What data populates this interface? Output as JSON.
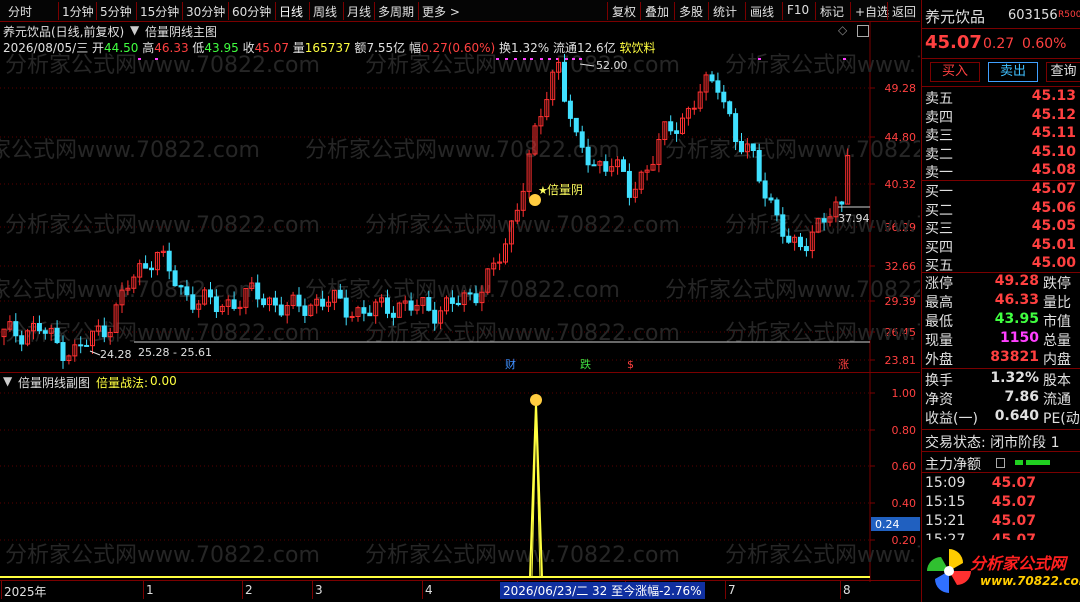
{
  "toolbar": {
    "left": [
      "分时",
      "1分钟",
      "5分钟",
      "15分钟",
      "30分钟",
      "60分钟",
      "日线",
      "周线",
      "月线",
      "多周期",
      "更多 >"
    ],
    "right": [
      "复权",
      "叠加",
      "多股",
      "统计",
      "画线",
      "F10",
      "标记",
      "+自选",
      "返回"
    ]
  },
  "main": {
    "title": "养元饮品(日线,前复权)",
    "indicator": "倍量阴线主图",
    "info": {
      "date": "2026/08/05/三",
      "open_label": "开",
      "open": "44.50",
      "high_label": "高",
      "high": "46.33",
      "low_label": "低",
      "low": "43.95",
      "close_label": "收",
      "close": "45.07",
      "vol_label": "量",
      "vol": "165737",
      "amt_label": "额",
      "amt": "7.55亿",
      "chg_label": "幅",
      "chg": "0.27(0.60%)",
      "turnover": "换1.32%",
      "float": "流通12.6亿",
      "sector": "软饮料"
    },
    "price_axis": [
      "49.28",
      "44.80",
      "40.32",
      "36.29",
      "32.66",
      "29.39",
      "26.45",
      "23.81"
    ],
    "annotations": {
      "high_mark": "52.00",
      "low_mark": "24.28",
      "range": "25.28 - 25.61",
      "signal": "倍量阴",
      "last": "37.94"
    },
    "events": [
      "财",
      "跌",
      "$",
      "涨"
    ]
  },
  "sub": {
    "title": "倍量阴线副图",
    "label": "倍量战法:",
    "value": "0.00",
    "axis": [
      "1.00",
      "0.80",
      "0.60",
      "0.40",
      "0.20"
    ],
    "cursor_value": "0.24"
  },
  "datebar": {
    "labels": [
      "2025年",
      "1",
      "2",
      "3",
      "4",
      "5",
      "6",
      "7",
      "8"
    ],
    "highlight": "2026/06/23/二 32 至今涨幅-2.76%"
  },
  "quote": {
    "name": "养元饮品",
    "code": "603156",
    "badge": "R500",
    "price": "45.07",
    "change": "0.27",
    "pct": "0.60%",
    "buy_btn": "买入",
    "sell_btn": "卖出",
    "query_btn": "查询",
    "asks": [
      {
        "label": "卖五",
        "price": "45.13"
      },
      {
        "label": "卖四",
        "price": "45.12"
      },
      {
        "label": "卖三",
        "price": "45.11"
      },
      {
        "label": "卖二",
        "price": "45.10"
      },
      {
        "label": "卖一",
        "price": "45.08"
      }
    ],
    "bids": [
      {
        "label": "买一",
        "price": "45.07"
      },
      {
        "label": "买二",
        "price": "45.06"
      },
      {
        "label": "买三",
        "price": "45.05"
      },
      {
        "label": "买四",
        "price": "45.01"
      },
      {
        "label": "买五",
        "price": "45.00"
      }
    ],
    "stats": [
      {
        "label": "涨停",
        "value": "49.28",
        "tail": "跌停"
      },
      {
        "label": "最高",
        "value": "46.33",
        "tail": "量比"
      },
      {
        "label": "最低",
        "value": "43.95",
        "tail": "市值"
      },
      {
        "label": "现量",
        "value": "1150",
        "tail": "总量"
      },
      {
        "label": "外盘",
        "value": "83821",
        "tail": "内盘"
      }
    ],
    "stats2": [
      {
        "label": "换手",
        "value": "1.32%",
        "tail": "股本"
      },
      {
        "label": "净资",
        "value": "7.86",
        "tail": "流通"
      },
      {
        "label": "收益(一)",
        "value": "0.640",
        "tail": "PE(动"
      }
    ],
    "trade_state": "交易状态: 闭市阶段 1",
    "mainflow": "主力净额",
    "ticks": [
      {
        "time": "15:09",
        "price": "45.07"
      },
      {
        "time": "15:15",
        "price": "45.07"
      },
      {
        "time": "15:21",
        "price": "45.07"
      },
      {
        "time": "15:27",
        "price": "45.07"
      }
    ],
    "logo": "分析家公式网",
    "logo_url": "www.70822.com"
  },
  "watermark": "分析家公式网www.70822.com"
}
